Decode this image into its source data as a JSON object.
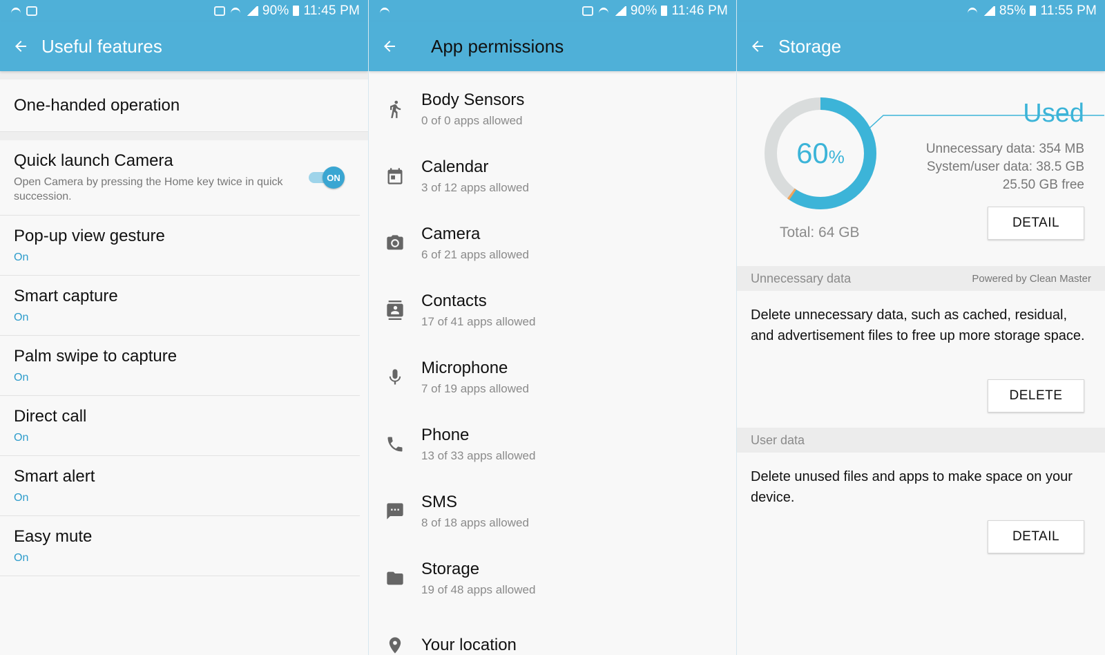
{
  "screen1": {
    "status": {
      "battery": "90%",
      "time": "11:45 PM"
    },
    "title": "Useful features",
    "one_handed": "One-handed operation",
    "quick_launch": {
      "title": "Quick launch Camera",
      "desc": "Open Camera by pressing the Home key twice in quick succession.",
      "toggle": "ON"
    },
    "items": [
      {
        "title": "Pop-up view gesture",
        "status": "On"
      },
      {
        "title": "Smart capture",
        "status": "On"
      },
      {
        "title": "Palm swipe to capture",
        "status": "On"
      },
      {
        "title": "Direct call",
        "status": "On"
      },
      {
        "title": "Smart alert",
        "status": "On"
      },
      {
        "title": "Easy mute",
        "status": "On"
      }
    ]
  },
  "screen2": {
    "status": {
      "battery": "90%",
      "time": "11:46 PM"
    },
    "title": "App permissions",
    "items": [
      {
        "icon": "running-person-icon",
        "title": "Body Sensors",
        "sub": "0 of 0 apps allowed"
      },
      {
        "icon": "calendar-icon",
        "title": "Calendar",
        "sub": "3 of 12 apps allowed"
      },
      {
        "icon": "camera-icon",
        "title": "Camera",
        "sub": "6 of 21 apps allowed"
      },
      {
        "icon": "contacts-icon",
        "title": "Contacts",
        "sub": "17 of 41 apps allowed"
      },
      {
        "icon": "microphone-icon",
        "title": "Microphone",
        "sub": "7 of 19 apps allowed"
      },
      {
        "icon": "phone-icon",
        "title": "Phone",
        "sub": "13 of 33 apps allowed"
      },
      {
        "icon": "sms-icon",
        "title": "SMS",
        "sub": "8 of 18 apps allowed"
      },
      {
        "icon": "folder-icon",
        "title": "Storage",
        "sub": "19 of 48 apps allowed"
      },
      {
        "icon": "location-icon",
        "title": "Your location",
        "sub": ""
      }
    ]
  },
  "screen3": {
    "status": {
      "battery": "85%",
      "time": "11:55 PM"
    },
    "title": "Storage",
    "used_pct": "60",
    "pct_sign": "%",
    "used_label": "Used",
    "unnecessary_line": "Unnecessary data: 354 MB",
    "system_line": "System/user data: 38.5 GB",
    "free_line": "25.50 GB free",
    "total": "Total: 64 GB",
    "detail_btn": "DETAIL",
    "unnecessary_head": "Unnecessary data",
    "powered_by": "Powered by Clean Master",
    "unnecessary_body": "Delete unnecessary data, such as cached, residual, and advertisement files to free up more storage space.",
    "delete_btn": "DELETE",
    "user_head": "User data",
    "user_body": "Delete unused files and apps to make space on your device.",
    "user_detail_btn": "DETAIL",
    "colors": {
      "accent": "#3cb4d8",
      "appbar": "#4fb0d8",
      "free_ring": "#d9dcdc",
      "orange_sliver": "#f0a35a"
    }
  }
}
